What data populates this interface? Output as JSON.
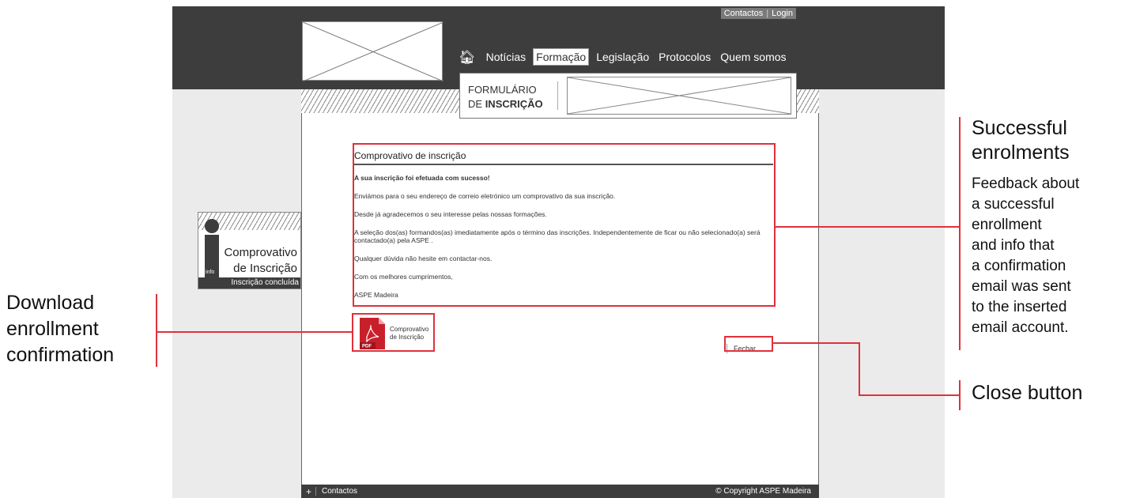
{
  "header": {
    "top_links": [
      "Contactos",
      "Login"
    ],
    "nav_items": [
      "Notícias",
      "Formação",
      "Legislação",
      "Protocolos",
      "Quem somos"
    ],
    "active_nav": "Formação",
    "home_icon": "home-icon"
  },
  "form_header": {
    "line1": "FORMULÁRIO",
    "line2_prefix": "DE",
    "line2_bold": "INSCRIÇÃO"
  },
  "widget": {
    "title_line1": "Comprovativo",
    "title_line2": "de Inscrição",
    "info_label": "info",
    "status": "Inscrição concluída"
  },
  "receipt": {
    "title": "Comprovativo de inscrição",
    "headline": "A sua inscrição foi efetuada com sucesso!",
    "paragraphs": [
      "Enviámos para o seu endereço de correio eletrónico um comprovativo da sua inscrição.",
      "Desde já agradecemos o seu interesse pelas nossas formações.",
      "A seleção dos(as) formandos(as) imediatamente após o término das inscrições. Independentemente de ficar ou não selecionado(a) será contactado(a) pela ASPE .",
      "Qualquer dúvida não hesite em contactar-nos.",
      "Com os melhores cumprimentos,",
      "ASPE Madeira"
    ]
  },
  "pdf_button": {
    "icon_label": "PDF",
    "line1": "Comprovativo",
    "line2": "de Inscrição"
  },
  "close_button": {
    "label": "Fechar"
  },
  "footer": {
    "plus": "+",
    "contact": "Contactos",
    "copyright": "© Copyright ASPE Madeira"
  },
  "annotations": {
    "success_title_line1": "Successful",
    "success_title_line2": "enrolments",
    "success_desc": [
      "Feedback about",
      "a successful",
      "enrollment",
      "and info that",
      "a confirmation",
      "email was sent",
      "to the inserted",
      "email account."
    ],
    "download": [
      "Download",
      "enrollment",
      "confirmation"
    ],
    "close": "Close button"
  },
  "colors": {
    "highlight": "#e0313c",
    "header_bg": "#3d3d3d",
    "pdf_red": "#c8202a"
  }
}
